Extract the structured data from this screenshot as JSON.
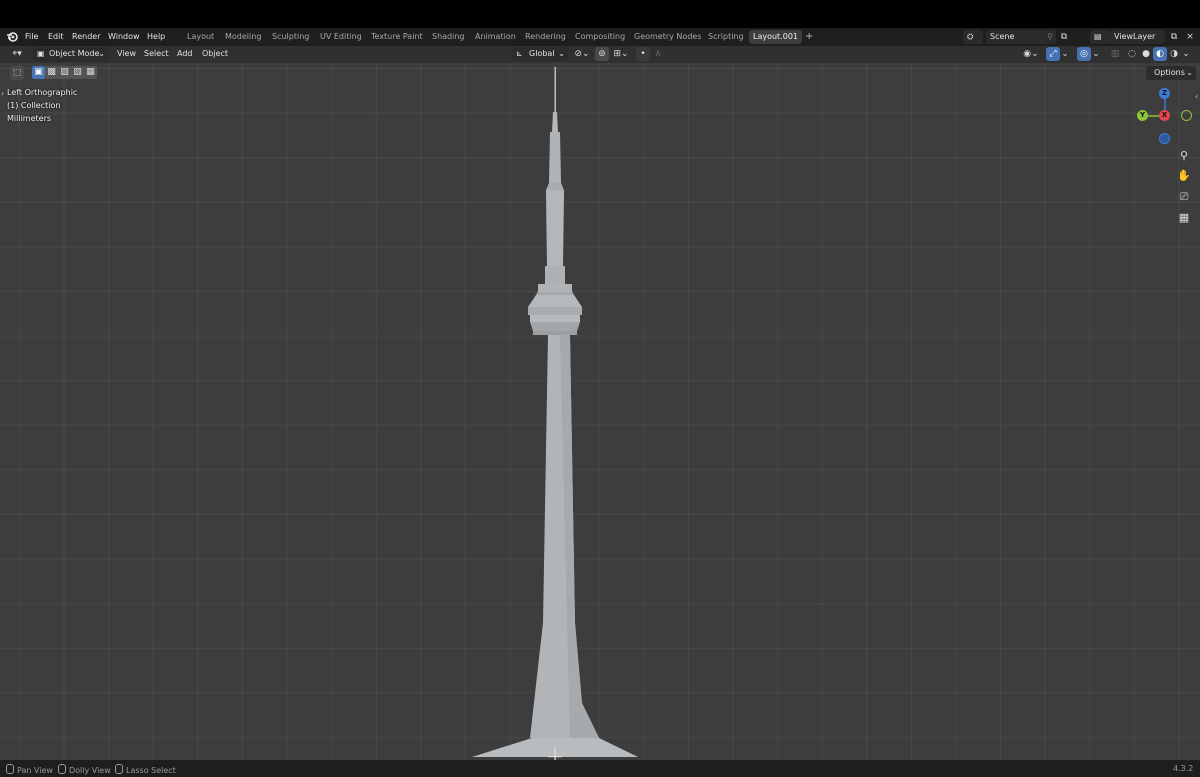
{
  "menu": {
    "items": [
      "File",
      "Edit",
      "Render",
      "Window",
      "Help"
    ]
  },
  "workspaces": {
    "tabs": [
      "Layout",
      "Modeling",
      "Sculpting",
      "UV Editing",
      "Texture Paint",
      "Shading",
      "Animation",
      "Rendering",
      "Compositing",
      "Geometry Nodes",
      "Scripting",
      "Layout.001"
    ],
    "active": "Layout.001",
    "add": "+"
  },
  "scene": {
    "name": "Scene"
  },
  "view_layer": {
    "name": "ViewLayer"
  },
  "viewport_header": {
    "mode": "Object Mode",
    "menus": [
      "View",
      "Select",
      "Add",
      "Object"
    ],
    "transform_orientation": "Global",
    "options_label": "Options"
  },
  "overlay": {
    "view_name": "Left Orthographic",
    "collection": "(1) Collection",
    "units": "Millimeters"
  },
  "gizmo": {
    "z": "Z",
    "x": "X",
    "y": "Y",
    "colors": {
      "z": "#3b7dd8",
      "x": "#e5434f",
      "y": "#8ac53c"
    }
  },
  "status_bar": {
    "items": [
      "Pan View",
      "Dolly View",
      "Lasso Select"
    ],
    "version": "4.3.2"
  },
  "colors": {
    "viewport_bg": "#3d3d3d",
    "header_bg": "#1e1e1e",
    "accent": "#4772b3",
    "object": "#b4b7ba"
  }
}
